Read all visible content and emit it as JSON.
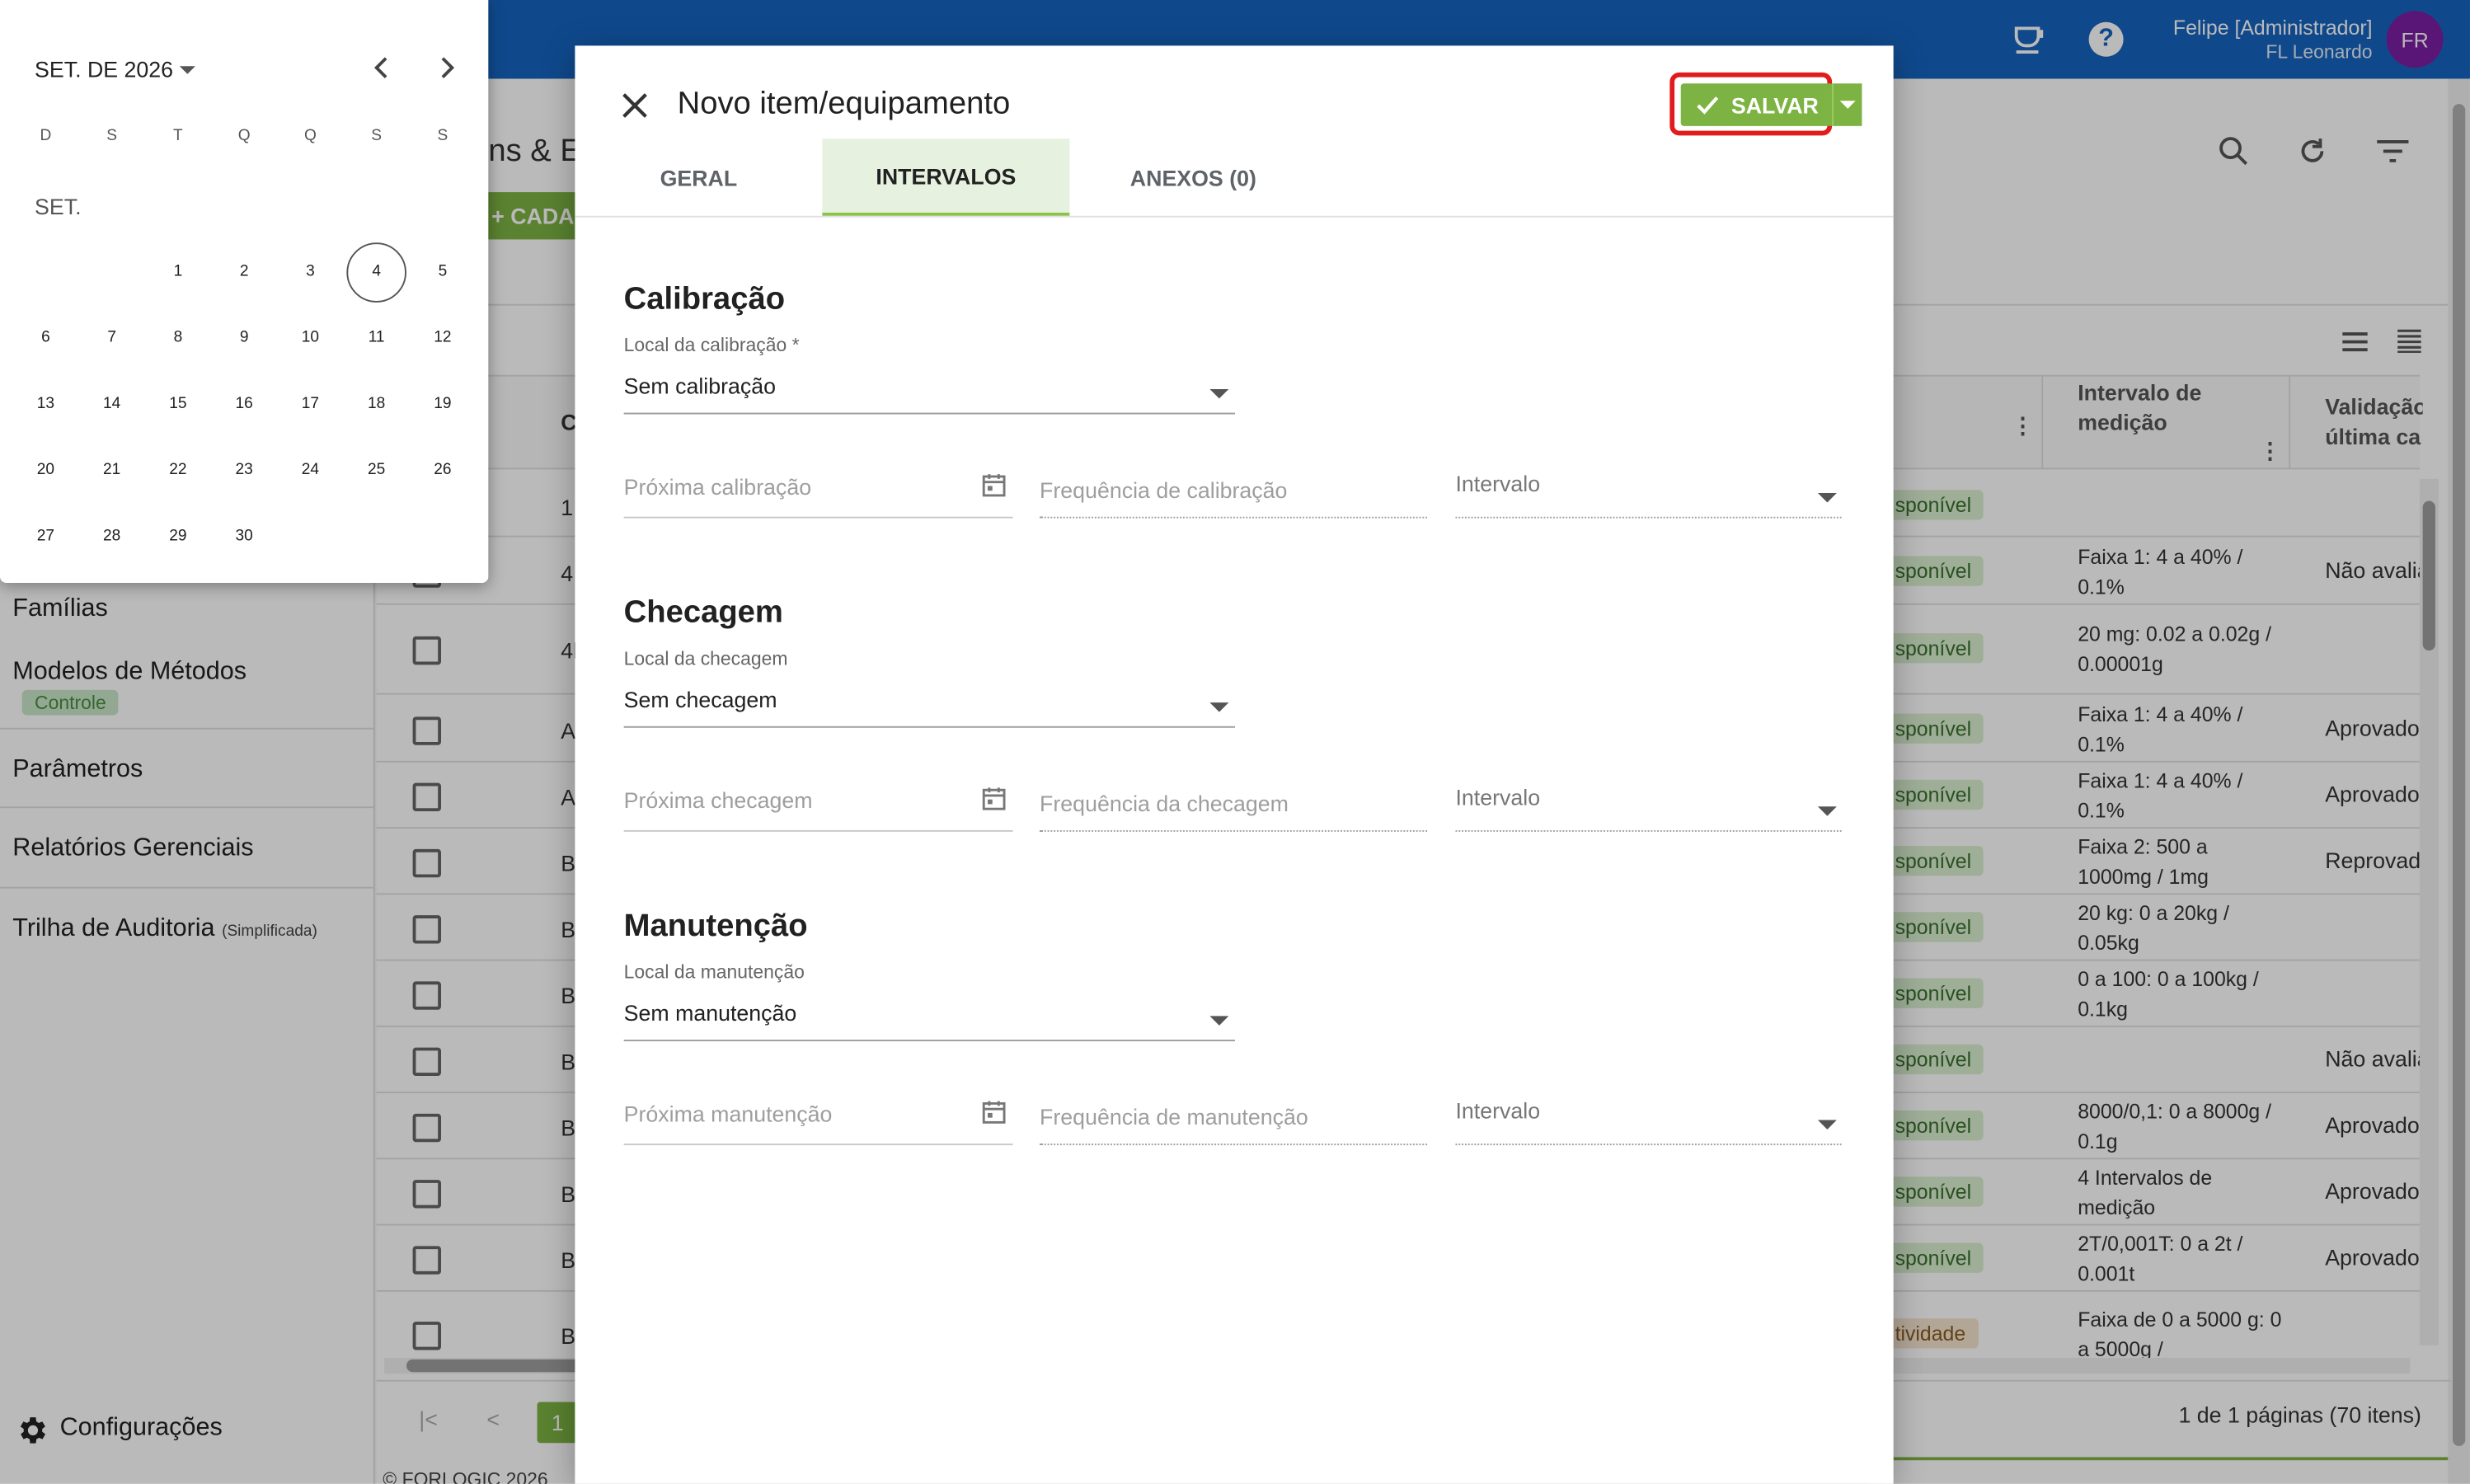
{
  "header": {
    "user_name": "Felipe [Administrador]",
    "user_sub": "FL Leonardo",
    "avatar_initials": "FR",
    "brand_color": "#1565c0"
  },
  "sidebar": {
    "items": [
      {
        "label": "Famílias"
      },
      {
        "label": "Modelos de Métodos",
        "tag": "Controle"
      },
      {
        "label": "Parâmetros"
      },
      {
        "label": "Relatórios Gerenciais"
      },
      {
        "label": "Trilha de Auditoria",
        "suffix": "(Simplificada)"
      }
    ],
    "settings_label": "Configurações"
  },
  "background": {
    "title_partial": "ns & E",
    "add_button_partial": "CADA",
    "column_code_partial": "C",
    "column_interval_header": "Intervalo de medição",
    "column_validation_header": "Validação última ca",
    "pagination": {
      "current_page": "1",
      "summary": "1 de 1 páginas (70 itens)"
    },
    "footer": "© FORLOGIC 2026",
    "rows": [
      {
        "code": "1",
        "status_badge": "sponível",
        "interval": "",
        "validation": ""
      },
      {
        "code": "4:",
        "status_badge": "sponível",
        "interval": "Faixa 1: 4 a 40% / 0.1%",
        "validation": "Não avalia"
      },
      {
        "code": "4l",
        "status_badge": "sponível",
        "interval": "20 mg: 0.02 a 0.02g / 0.00001g",
        "validation": ""
      },
      {
        "code": "A",
        "status_badge": "sponível",
        "interval": "Faixa 1: 4 a 40% / 0.1%",
        "validation": "Aprovado"
      },
      {
        "code": "A",
        "status_badge": "sponível",
        "interval": "Faixa 1: 4 a 40% / 0.1%",
        "validation": "Aprovado"
      },
      {
        "code": "B",
        "status_badge": "sponível",
        "interval": "Faixa 2: 500 a 1000mg / 1mg",
        "validation": "Reprovado"
      },
      {
        "code": "B",
        "status_badge": "sponível",
        "interval": "20 kg: 0 a 20kg / 0.05kg",
        "validation": ""
      },
      {
        "code": "B",
        "status_badge": "sponível",
        "interval": "0 a 100: 0 a 100kg / 0.1kg",
        "validation": ""
      },
      {
        "code": "B",
        "status_badge": "sponível",
        "interval": "",
        "validation": "Não avalia"
      },
      {
        "code": "B",
        "status_badge": "sponível",
        "interval": "8000/0,1: 0 a 8000g / 0.1g",
        "validation": "Aprovado"
      },
      {
        "code": "B",
        "status_badge": "sponível",
        "interval": "4 Intervalos de medição",
        "validation": "Aprovado"
      },
      {
        "code": "B",
        "status_badge": "sponível",
        "interval": "2T/0,001T: 0 a 2t / 0.001t",
        "validation": "Aprovado"
      },
      {
        "code": "B",
        "status_badge": "tividade",
        "interval": "Faixa de 0 a 5000 g: 0 a 5000g /",
        "validation": ""
      }
    ]
  },
  "dialog": {
    "title": "Novo item/equipamento",
    "save_label": "SALVAR",
    "tabs": [
      {
        "label": "GERAL"
      },
      {
        "label": "INTERVALOS"
      },
      {
        "label": "ANEXOS (0)"
      }
    ],
    "sections": [
      {
        "title": "Calibração",
        "local_label": "Local da calibração *",
        "local_value": "Sem calibração",
        "next_placeholder": "Próxima calibração",
        "freq_placeholder": "Frequência de calibração",
        "interval_placeholder": "Intervalo"
      },
      {
        "title": "Checagem",
        "local_label": "Local da checagem",
        "local_value": "Sem checagem",
        "next_placeholder": "Próxima checagem",
        "freq_placeholder": "Frequência da checagem",
        "interval_placeholder": "Intervalo"
      },
      {
        "title": "Manutenção",
        "local_label": "Local da manutenção",
        "local_value": "Sem manutenção",
        "next_placeholder": "Próxima manutenção",
        "freq_placeholder": "Frequência de manutenção",
        "interval_placeholder": "Intervalo"
      }
    ],
    "accent_color": "#7cb342",
    "highlight_color": "#e21b1b"
  },
  "calendar": {
    "month_label": "SET. DE 2026",
    "month_short": "SET.",
    "weekdays": [
      "D",
      "S",
      "T",
      "Q",
      "Q",
      "S",
      "S"
    ],
    "weeks": [
      [
        "",
        "",
        "1",
        "2",
        "3",
        "4",
        "5"
      ],
      [
        "6",
        "7",
        "8",
        "9",
        "10",
        "11",
        "12"
      ],
      [
        "13",
        "14",
        "15",
        "16",
        "17",
        "18",
        "19"
      ],
      [
        "20",
        "21",
        "22",
        "23",
        "24",
        "25",
        "26"
      ],
      [
        "27",
        "28",
        "29",
        "30",
        "",
        "",
        ""
      ]
    ],
    "today": "4"
  }
}
